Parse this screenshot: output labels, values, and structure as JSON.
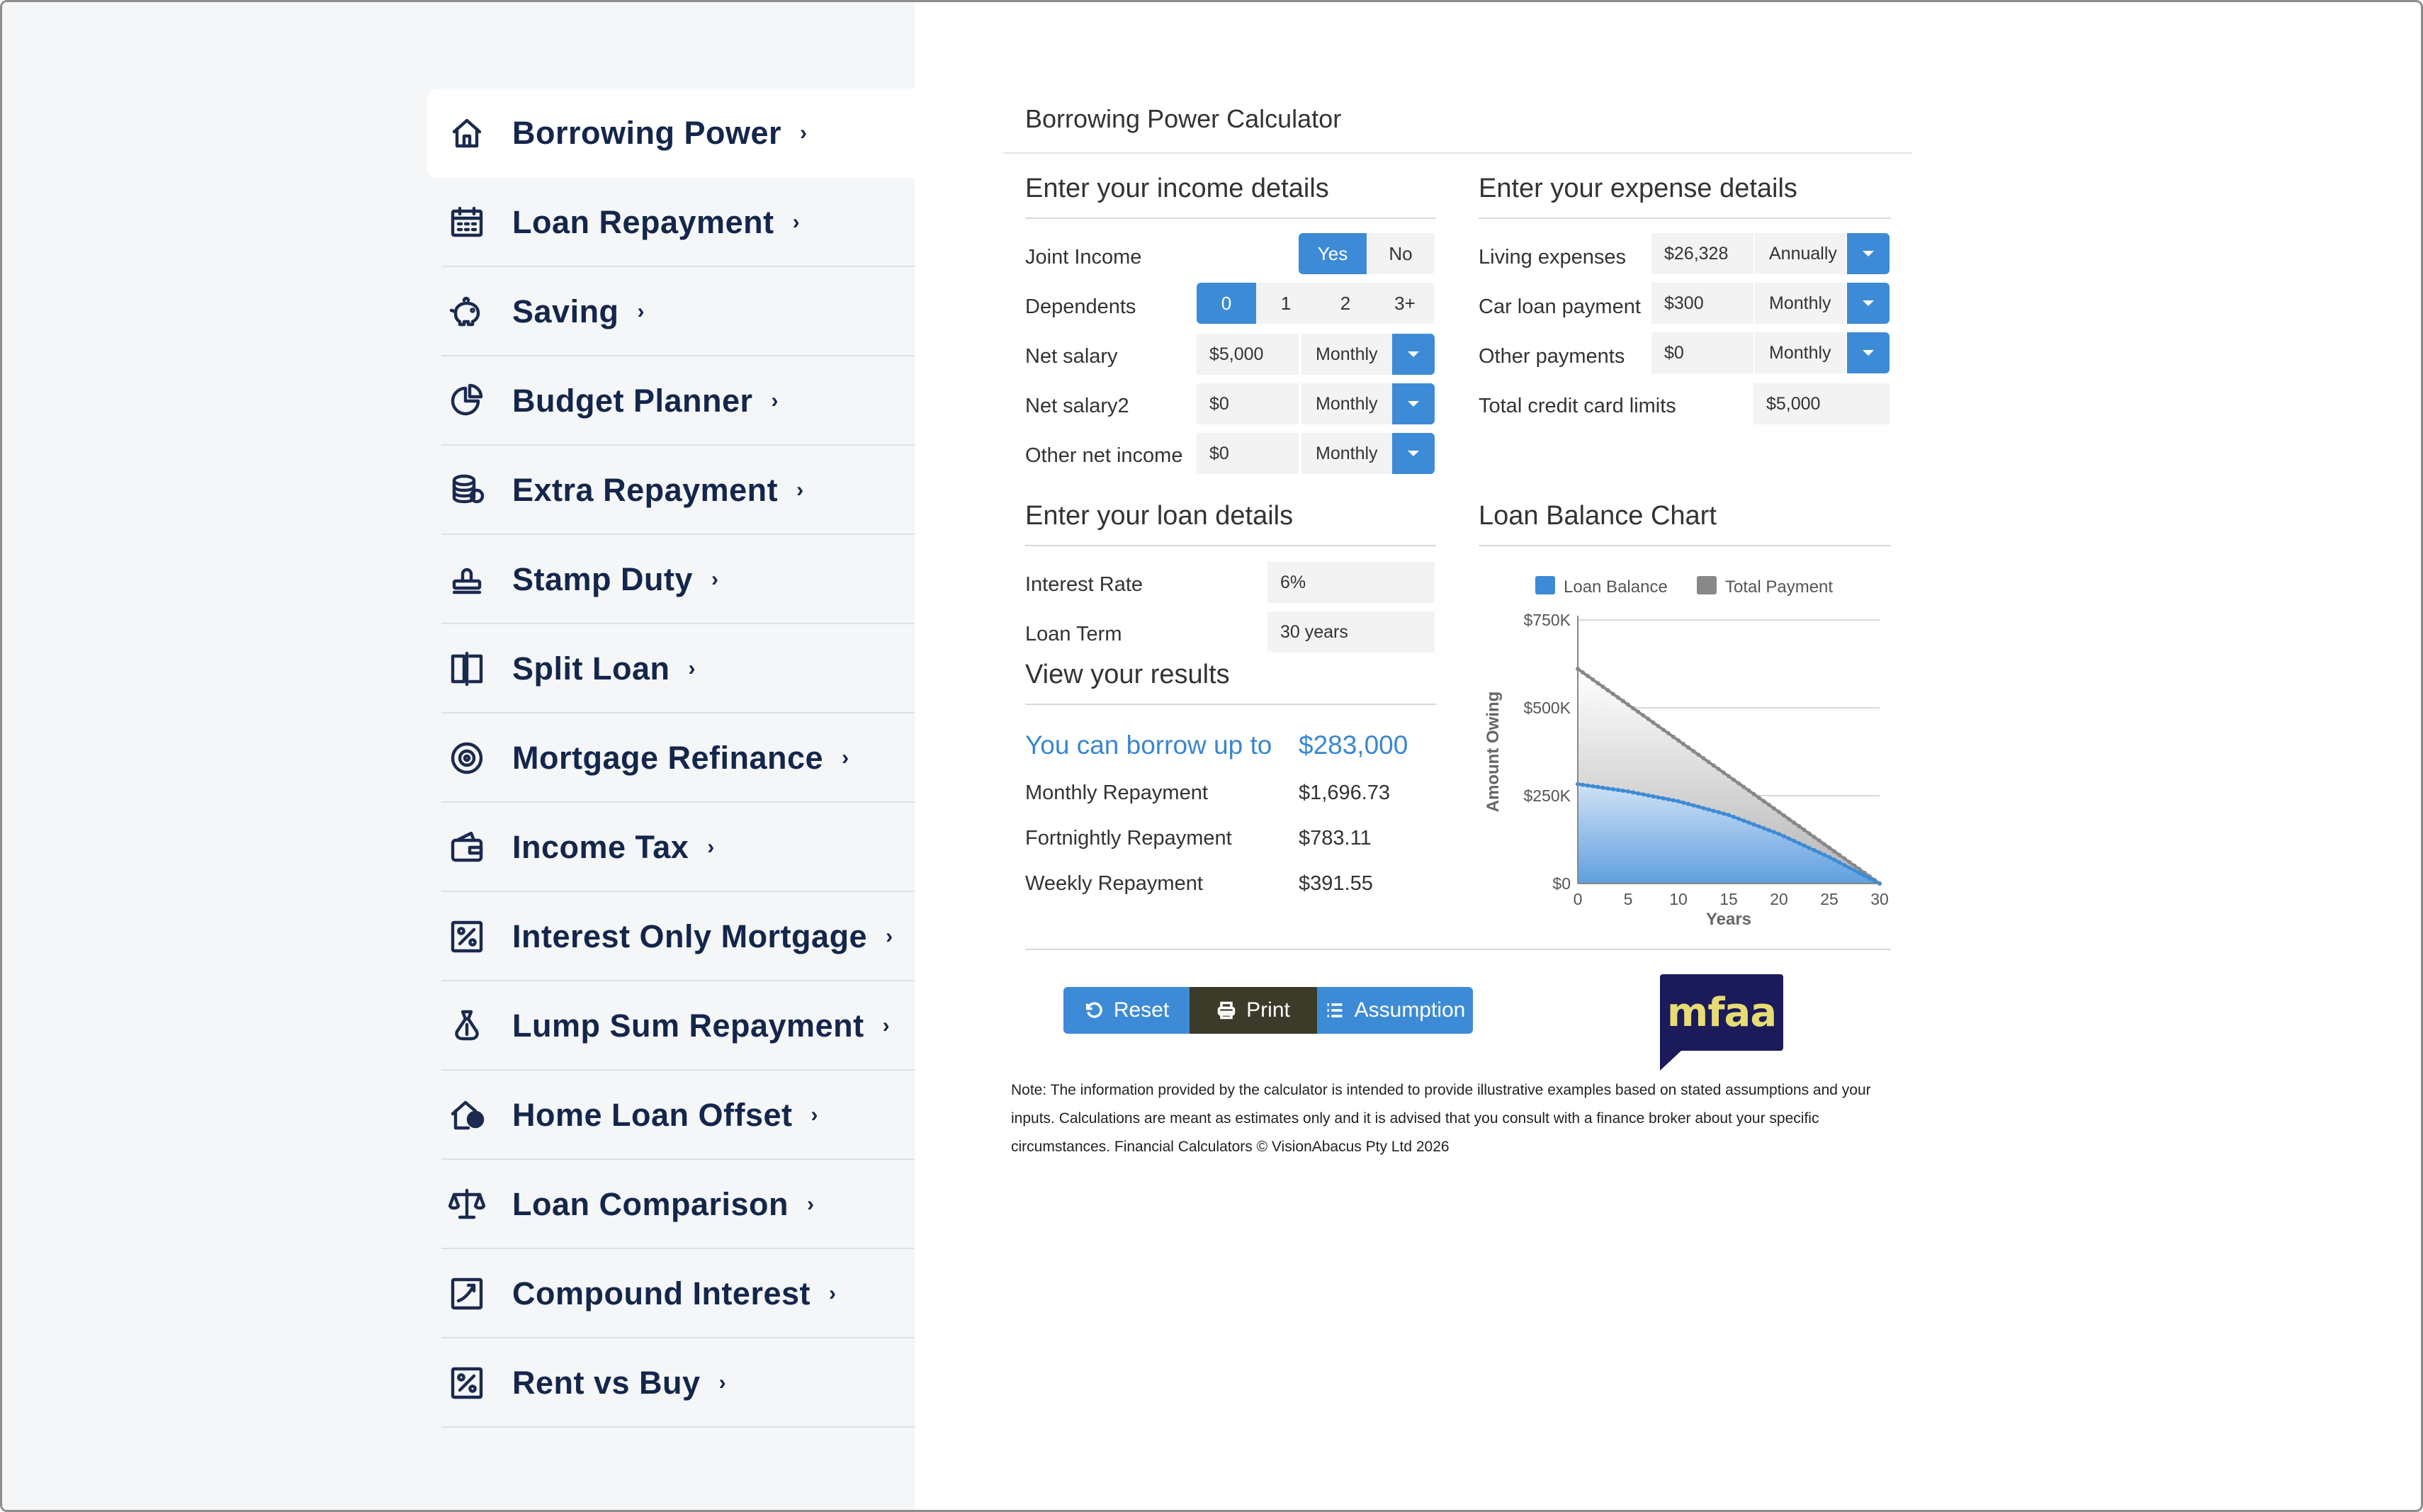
{
  "sidebar": {
    "items": [
      {
        "label": "Borrowing Power",
        "icon": "home-icon",
        "active": true
      },
      {
        "label": "Loan Repayment",
        "icon": "calendar-icon"
      },
      {
        "label": "Saving",
        "icon": "piggy-bank-icon"
      },
      {
        "label": "Budget Planner",
        "icon": "pie-chart-icon"
      },
      {
        "label": "Extra Repayment",
        "icon": "coins-icon"
      },
      {
        "label": "Stamp Duty",
        "icon": "stamp-icon"
      },
      {
        "label": "Split Loan",
        "icon": "split-icon"
      },
      {
        "label": "Mortgage Refinance",
        "icon": "target-icon"
      },
      {
        "label": "Income Tax",
        "icon": "wallet-icon"
      },
      {
        "label": "Interest Only Mortgage",
        "icon": "percent-icon"
      },
      {
        "label": "Lump Sum Repayment",
        "icon": "money-bag-icon"
      },
      {
        "label": "Home Loan Offset",
        "icon": "home-offset-icon"
      },
      {
        "label": "Loan Comparison",
        "icon": "scales-icon"
      },
      {
        "label": "Compound Interest",
        "icon": "growth-chart-icon"
      },
      {
        "label": "Rent vs Buy",
        "icon": "percent-icon"
      }
    ],
    "chevron": "›"
  },
  "main": {
    "title": "Borrowing Power Calculator",
    "income": {
      "title": "Enter your income details",
      "joint_label": "Joint Income",
      "joint_options": [
        "Yes",
        "No"
      ],
      "joint_selected": "Yes",
      "dependents_label": "Dependents",
      "dependents_options": [
        "0",
        "1",
        "2",
        "3+"
      ],
      "dependents_selected": "0",
      "net_salary_label": "Net salary",
      "net_salary_value": "$5,000",
      "net_salary_period": "Monthly",
      "net_salary2_label": "Net salary2",
      "net_salary2_value": "$0",
      "net_salary2_period": "Monthly",
      "other_label": "Other net income",
      "other_value": "$0",
      "other_period": "Monthly"
    },
    "expense": {
      "title": "Enter your expense details",
      "living_label": "Living expenses",
      "living_value": "$26,328",
      "living_period": "Annually",
      "car_label": "Car loan payment",
      "car_value": "$300",
      "car_period": "Monthly",
      "other_label": "Other payments",
      "other_value": "$0",
      "other_period": "Monthly",
      "credit_label": "Total credit card limits",
      "credit_value": "$5,000"
    },
    "loan": {
      "title": "Enter your loan details",
      "rate_label": "Interest Rate",
      "rate_value": "6%",
      "term_label": "Loan Term",
      "term_value": "30 years"
    },
    "results": {
      "title": "View your results",
      "borrow_label": "You can borrow up to",
      "borrow_value": "$283,000",
      "monthly_label": "Monthly Repayment",
      "monthly_value": "$1,696.73",
      "fortnightly_label": "Fortnightly Repayment",
      "fortnightly_value": "$783.11",
      "weekly_label": "Weekly Repayment",
      "weekly_value": "$391.55"
    },
    "chart_title": "Loan Balance Chart",
    "buttons": {
      "reset": "Reset",
      "print": "Print",
      "assumption": "Assumption"
    },
    "logo_text": "mfaa",
    "note": "Note: The information provided by the calculator is intended to provide illustrative examples based on stated assumptions and your inputs. Calculations are meant as estimates only and it is advised that you consult with a finance broker about your specific circumstances. Financial Calculators © VisionAbacus Pty Ltd 2026"
  },
  "colors": {
    "accent": "#3d8bd6",
    "print_button": "#3c3a28",
    "nav_text": "#14264b",
    "loan_balance": "#3d8bd6",
    "total_payment": "#888888"
  },
  "chart_data": {
    "type": "area",
    "title": "",
    "xlabel": "Years",
    "ylabel": "Amount Owing",
    "x": [
      0,
      5,
      10,
      15,
      20,
      25,
      30
    ],
    "xticks": [
      "0",
      "5",
      "10",
      "15",
      "20",
      "25",
      "30"
    ],
    "yticks": [
      "$0",
      "$250K",
      "$500K",
      "$750K"
    ],
    "ytick_values": [
      0,
      250000,
      500000,
      750000
    ],
    "ylim": [
      0,
      750000
    ],
    "xlim": [
      0,
      30
    ],
    "legend": "top",
    "grid": true,
    "series": [
      {
        "name": "Loan Balance",
        "color": "#3d8bd6",
        "values": [
          283000,
          262000,
          234000,
          195000,
          141000,
          75000,
          0
        ]
      },
      {
        "name": "Total Payment",
        "color": "#888888",
        "values": [
          610800,
          509000,
          407200,
          305400,
          203600,
          101800,
          0
        ]
      }
    ]
  }
}
